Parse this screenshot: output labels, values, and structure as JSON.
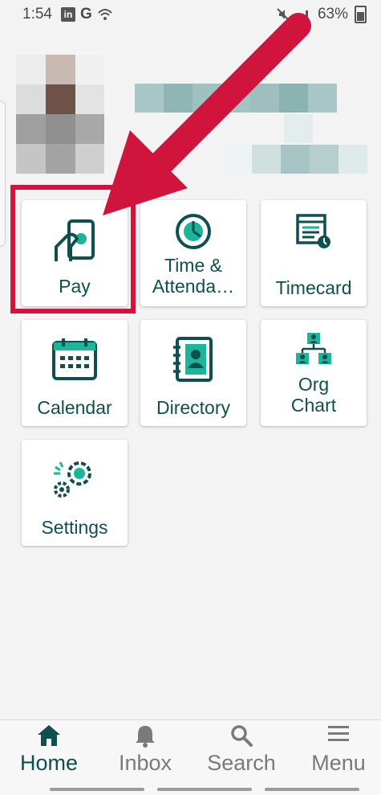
{
  "status_bar": {
    "time": "1:54",
    "battery": "63%",
    "icons": [
      "linkedin-icon",
      "google-icon",
      "wifi-icon",
      "mute-icon",
      "signal-icon",
      "battery-icon"
    ]
  },
  "tiles": [
    {
      "id": "pay",
      "label": "Pay",
      "icon": "hand-card-icon"
    },
    {
      "id": "time",
      "label": "Time &\nAttenda…",
      "icon": "clock-icon"
    },
    {
      "id": "timecard",
      "label": "Timecard",
      "icon": "timecard-icon"
    },
    {
      "id": "calendar",
      "label": "Calendar",
      "icon": "calendar-icon"
    },
    {
      "id": "directory",
      "label": "Directory",
      "icon": "address-book-icon"
    },
    {
      "id": "org",
      "label": "Org\nChart",
      "icon": "org-chart-icon"
    },
    {
      "id": "settings",
      "label": "Settings",
      "icon": "gears-icon"
    }
  ],
  "nav": {
    "home": "Home",
    "inbox": "Inbox",
    "search": "Search",
    "menu": "Menu"
  },
  "colors": {
    "brand": "#0f4f4f",
    "accent": "#1bb59a",
    "highlight": "#d0143c"
  }
}
